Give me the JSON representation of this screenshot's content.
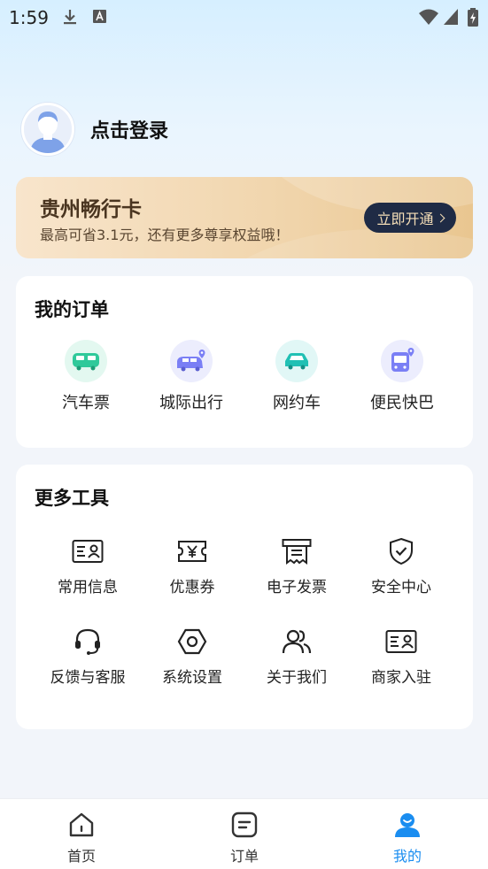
{
  "status_bar": {
    "time": "1:59",
    "icons": [
      "download-icon",
      "a-icon",
      "wifi-icon",
      "signal-icon",
      "battery-icon"
    ]
  },
  "profile": {
    "login_text": "点击登录"
  },
  "vip_card": {
    "title": "贵州畅行卡",
    "subtitle": "最高可省3.1元，还有更多尊享权益哦！",
    "button_label": "立即开通"
  },
  "orders": {
    "title": "我的订单",
    "items": [
      {
        "label": "汽车票",
        "icon": "bus-icon",
        "color": "#2fc99a"
      },
      {
        "label": "城际出行",
        "icon": "intercity-car-icon",
        "color": "#7a7ff5"
      },
      {
        "label": "网约车",
        "icon": "car-icon",
        "color": "#20c0b4"
      },
      {
        "label": "便民快巴",
        "icon": "minibus-icon",
        "color": "#7a7ff5"
      }
    ]
  },
  "tools": {
    "title": "更多工具",
    "items": [
      {
        "label": "常用信息",
        "icon": "id-card-icon"
      },
      {
        "label": "优惠券",
        "icon": "coupon-icon"
      },
      {
        "label": "电子发票",
        "icon": "invoice-icon"
      },
      {
        "label": "安全中心",
        "icon": "shield-icon"
      },
      {
        "label": "反馈与客服",
        "icon": "headset-icon"
      },
      {
        "label": "系统设置",
        "icon": "settings-icon"
      },
      {
        "label": "关于我们",
        "icon": "people-icon"
      },
      {
        "label": "商家入驻",
        "icon": "merchant-card-icon"
      }
    ]
  },
  "bottom_nav": {
    "items": [
      {
        "label": "首页",
        "icon": "home-icon"
      },
      {
        "label": "订单",
        "icon": "orders-icon"
      },
      {
        "label": "我的",
        "icon": "profile-icon",
        "active": true
      }
    ],
    "active_color": "#1a8df0"
  }
}
